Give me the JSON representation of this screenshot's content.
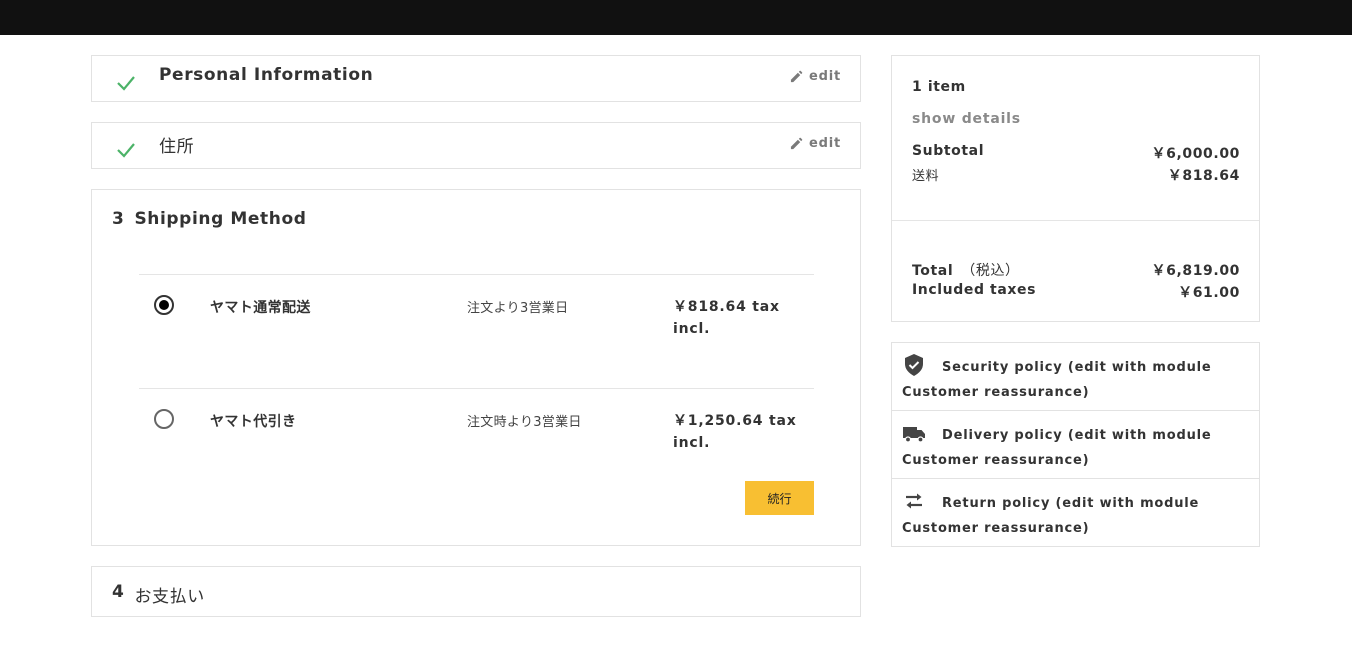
{
  "checkout": {
    "personal": {
      "title": "Personal Information",
      "edit_label": "edit"
    },
    "address": {
      "title": "住所",
      "edit_label": "edit"
    },
    "shipping": {
      "step_number": "3",
      "title": "Shipping Method",
      "carriers": [
        {
          "name": "ヤマト通常配送",
          "delay": "注文より3営業日",
          "price": "￥818.64 tax incl.",
          "selected": true
        },
        {
          "name": "ヤマト代引き",
          "delay": "注文時より3営業日",
          "price": "￥1,250.64 tax incl.",
          "selected": false
        }
      ],
      "continue_label": "続行"
    },
    "payment": {
      "step_number": "4",
      "title": "お支払い"
    }
  },
  "summary": {
    "items_count": "1 item",
    "show_details": "show details",
    "subtotal_label": "Subtotal",
    "subtotal_value": "￥6,000.00",
    "shipping_label": "送料",
    "shipping_value": "￥818.64",
    "total_label": "Total",
    "total_note": "（税込）",
    "total_value": "￥6,819.00",
    "taxes_label": "Included taxes",
    "taxes_value": "￥61.00"
  },
  "reassurance": [
    {
      "icon": "shield-check-icon",
      "text": "Security policy (edit with module Customer reassurance)"
    },
    {
      "icon": "truck-icon",
      "text": "Delivery policy (edit with module Customer reassurance)"
    },
    {
      "icon": "swap-arrows-icon",
      "text": "Return policy (edit with module Customer reassurance)"
    }
  ],
  "colors": {
    "accent_button": "#f8bf32",
    "check_green": "#4cb368",
    "header_bar": "#111111"
  }
}
